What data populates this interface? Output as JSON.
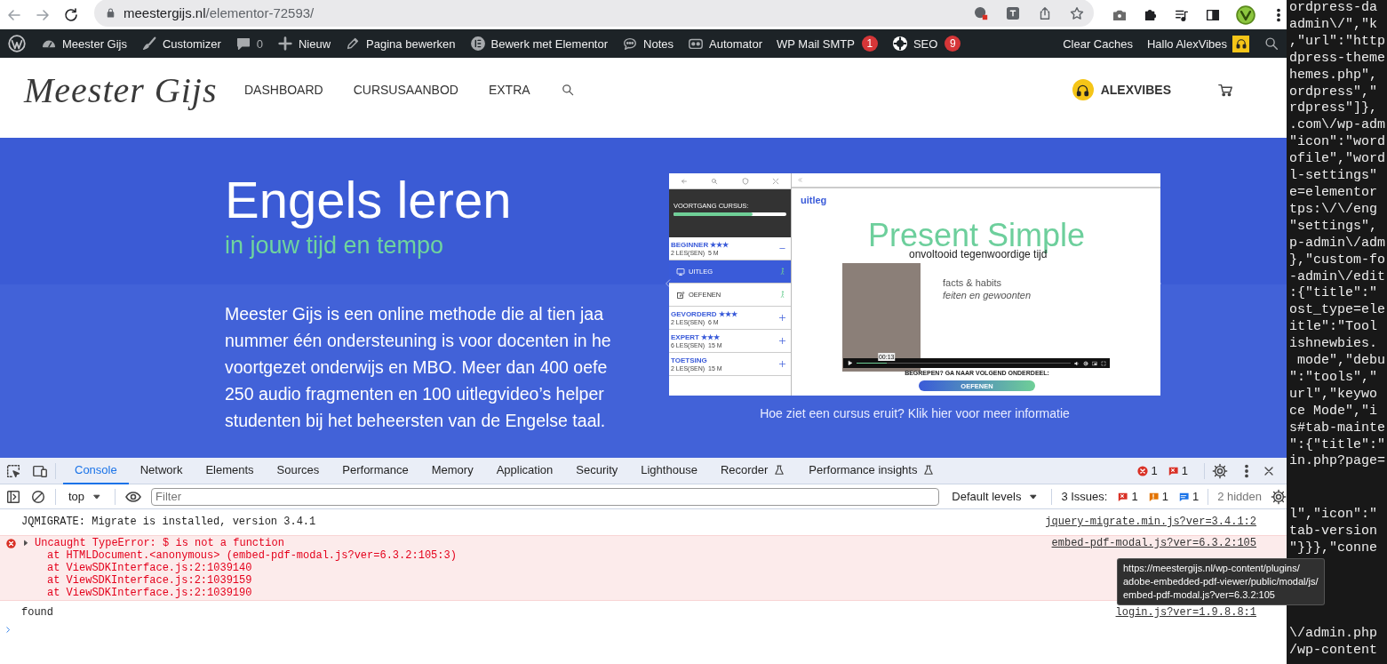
{
  "browser": {
    "address": {
      "host": "meestergijs.nl",
      "path": "/elementor-72593/"
    }
  },
  "admin_bar": {
    "items": [
      {
        "kind": "wordpress"
      },
      {
        "kind": "dashboard",
        "label": "Meester Gijs"
      },
      {
        "kind": "brush",
        "label": "Customizer"
      },
      {
        "kind": "comment",
        "label": "0"
      },
      {
        "kind": "plus",
        "label": "Nieuw"
      },
      {
        "kind": "pencil",
        "label": "Pagina bewerken"
      },
      {
        "kind": "elementor",
        "label": "Bewerk met Elementor"
      },
      {
        "kind": "chat",
        "label": "Notes"
      },
      {
        "kind": "robot",
        "label": "Automator"
      },
      {
        "kind": "text",
        "label": "WP Mail SMTP",
        "badge": "1"
      },
      {
        "kind": "gear",
        "label": "SEO",
        "badge": "9"
      }
    ],
    "right_items": [
      {
        "kind": "text",
        "label": "Clear Caches"
      },
      {
        "kind": "avatar",
        "label": "Hallo AlexVibes"
      }
    ]
  },
  "site_header": {
    "logo": "Meester Gijs",
    "nav": [
      "DASHBOARD",
      "CURSUSAANBOD",
      "EXTRA"
    ],
    "user": "ALEXVIBES"
  },
  "hero": {
    "title": "Engels leren",
    "subtitle": "in jouw tijd en tempo",
    "paragraph_lines": [
      "Meester Gijs is een online methode die al tien jaa",
      "nummer één ondersteuning is voor docenten in he",
      "voortgezet onderwijs en MBO. Meer dan 400 oefe",
      "250 audio fragmenten en 100 uitlegvideo’s helper",
      "studenten bij het beheersten van de Engelse taal."
    ],
    "slide": {
      "progress_label": "VOORTGANG CURSUS:",
      "level": 0.7,
      "sections": [
        {
          "title": "BEGINNER ★★★",
          "meta": "2 LES(SEN)  5 M",
          "expanded": true,
          "children": [
            {
              "kind": "video",
              "label": "UITLEG",
              "selected": true
            },
            {
              "kind": "exercise",
              "label": "OEFENEN",
              "selected": false
            }
          ]
        },
        {
          "title": "GEVORDERD ★★★",
          "meta": "2 LES(SEN)  6 M",
          "expanded": false
        },
        {
          "title": "EXPERT ★★★",
          "meta": "6 LES(SEN)  15 M",
          "expanded": false
        },
        {
          "title": "TOETSING",
          "meta": "2 LES(SEN)  15 M",
          "expanded": false
        }
      ],
      "lesson_label": "uitleg",
      "heading": "Present Simple",
      "subheading": "onvoltooid tegenwoordige tijd",
      "points": [
        "facts & habits",
        "feiten en gewoonten"
      ],
      "video": {
        "time": "00:13",
        "level": 0.14
      },
      "prompt": "BEGREPEN? GA NAAR VOLGEND ONDERDEEL:",
      "button": "OEFENEN"
    },
    "caption": "Hoe ziet een cursus eruit? Klik hier voor meer informatie"
  },
  "devtools": {
    "tabs": [
      {
        "label": "Console",
        "selected": true,
        "beta": false
      },
      {
        "label": "Network",
        "selected": false,
        "beta": false
      },
      {
        "label": "Elements",
        "selected": false,
        "beta": false
      },
      {
        "label": "Sources",
        "selected": false,
        "beta": false
      },
      {
        "label": "Performance",
        "selected": false,
        "beta": false
      },
      {
        "label": "Memory",
        "selected": false,
        "beta": false
      },
      {
        "label": "Application",
        "selected": false,
        "beta": false
      },
      {
        "label": "Security",
        "selected": false,
        "beta": false
      },
      {
        "label": "Lighthouse",
        "selected": false,
        "beta": false
      },
      {
        "label": "Recorder",
        "selected": false,
        "beta": true
      },
      {
        "label": "Performance insights",
        "selected": false,
        "beta": true
      }
    ],
    "error_count": "1",
    "issue_count": "1",
    "context": "top",
    "filter_placeholder": "Filter",
    "levels": "Default levels",
    "issues_label": "3 Issues:",
    "issue_badges": [
      {
        "kind": "error",
        "count": "1"
      },
      {
        "kind": "warning",
        "count": "1"
      },
      {
        "kind": "info",
        "count": "1"
      }
    ],
    "hidden": "2 hidden",
    "messages": [
      {
        "kind": "log",
        "text": "JQMIGRATE: Migrate is installed, version 3.4.1",
        "source": "jquery-migrate.min.js?ver=3.4.1:2"
      },
      {
        "kind": "error",
        "text": "Uncaught TypeError: $ is not a function",
        "source": "embed-pdf-modal.js?ver=6.3.2:105",
        "stack": [
          {
            "prefix": "at HTMLDocument.<anonymous> (",
            "link": "embed-pdf-modal.js?ver=6.3.2:105:3",
            "suffix": ")"
          },
          {
            "prefix": "at ",
            "link": "ViewSDKInterface.js:2:1039140"
          },
          {
            "prefix": "at ",
            "link": "ViewSDKInterface.js:2:1039159"
          },
          {
            "prefix": "at ",
            "link": "ViewSDKInterface.js:2:1039190"
          }
        ]
      },
      {
        "kind": "log",
        "text": "found",
        "source": "login.js?ver=1.9.8.8:1"
      }
    ],
    "tooltip_lines": [
      "https://meestergijs.nl/wp-content/plugins/",
      "adobe-embedded-pdf-viewer/public/modal/js/",
      "embed-pdf-modal.js?ver=6.3.2:105"
    ]
  },
  "code_panel": {
    "groups": [
      [
        "ordpress-da",
        "admin\\/\",\"k",
        ",\"url\":\"http",
        "dpress-theme",
        "hemes.php\",",
        "ordpress\",\"",
        "rdpress\"]},",
        ".com\\/wp-adm",
        "\"icon\":\"word",
        "ofile\",\"word",
        "l-settings\"",
        "e=elementor",
        "tps:\\/\\/eng",
        "\"settings\",",
        "p-admin\\/adm",
        "},\"custom-fo",
        "-admin\\/edit",
        ":{\"title\":\"",
        "ost_type=ele",
        "itle\":\"Tool",
        "ishnewbies.",
        " mode\",\"debu",
        "\":\"tools\",\"",
        "url\",\"keywo",
        "ce Mode\",\"i",
        "s#tab-mainte",
        "\":{\"title\":\"",
        "in.php?page="
      ],
      [
        "l\",\"icon\":\"",
        "tab-version",
        "\"}}},\"conne"
      ],
      [
        "\\/admin.php",
        "/wp-content"
      ]
    ]
  }
}
